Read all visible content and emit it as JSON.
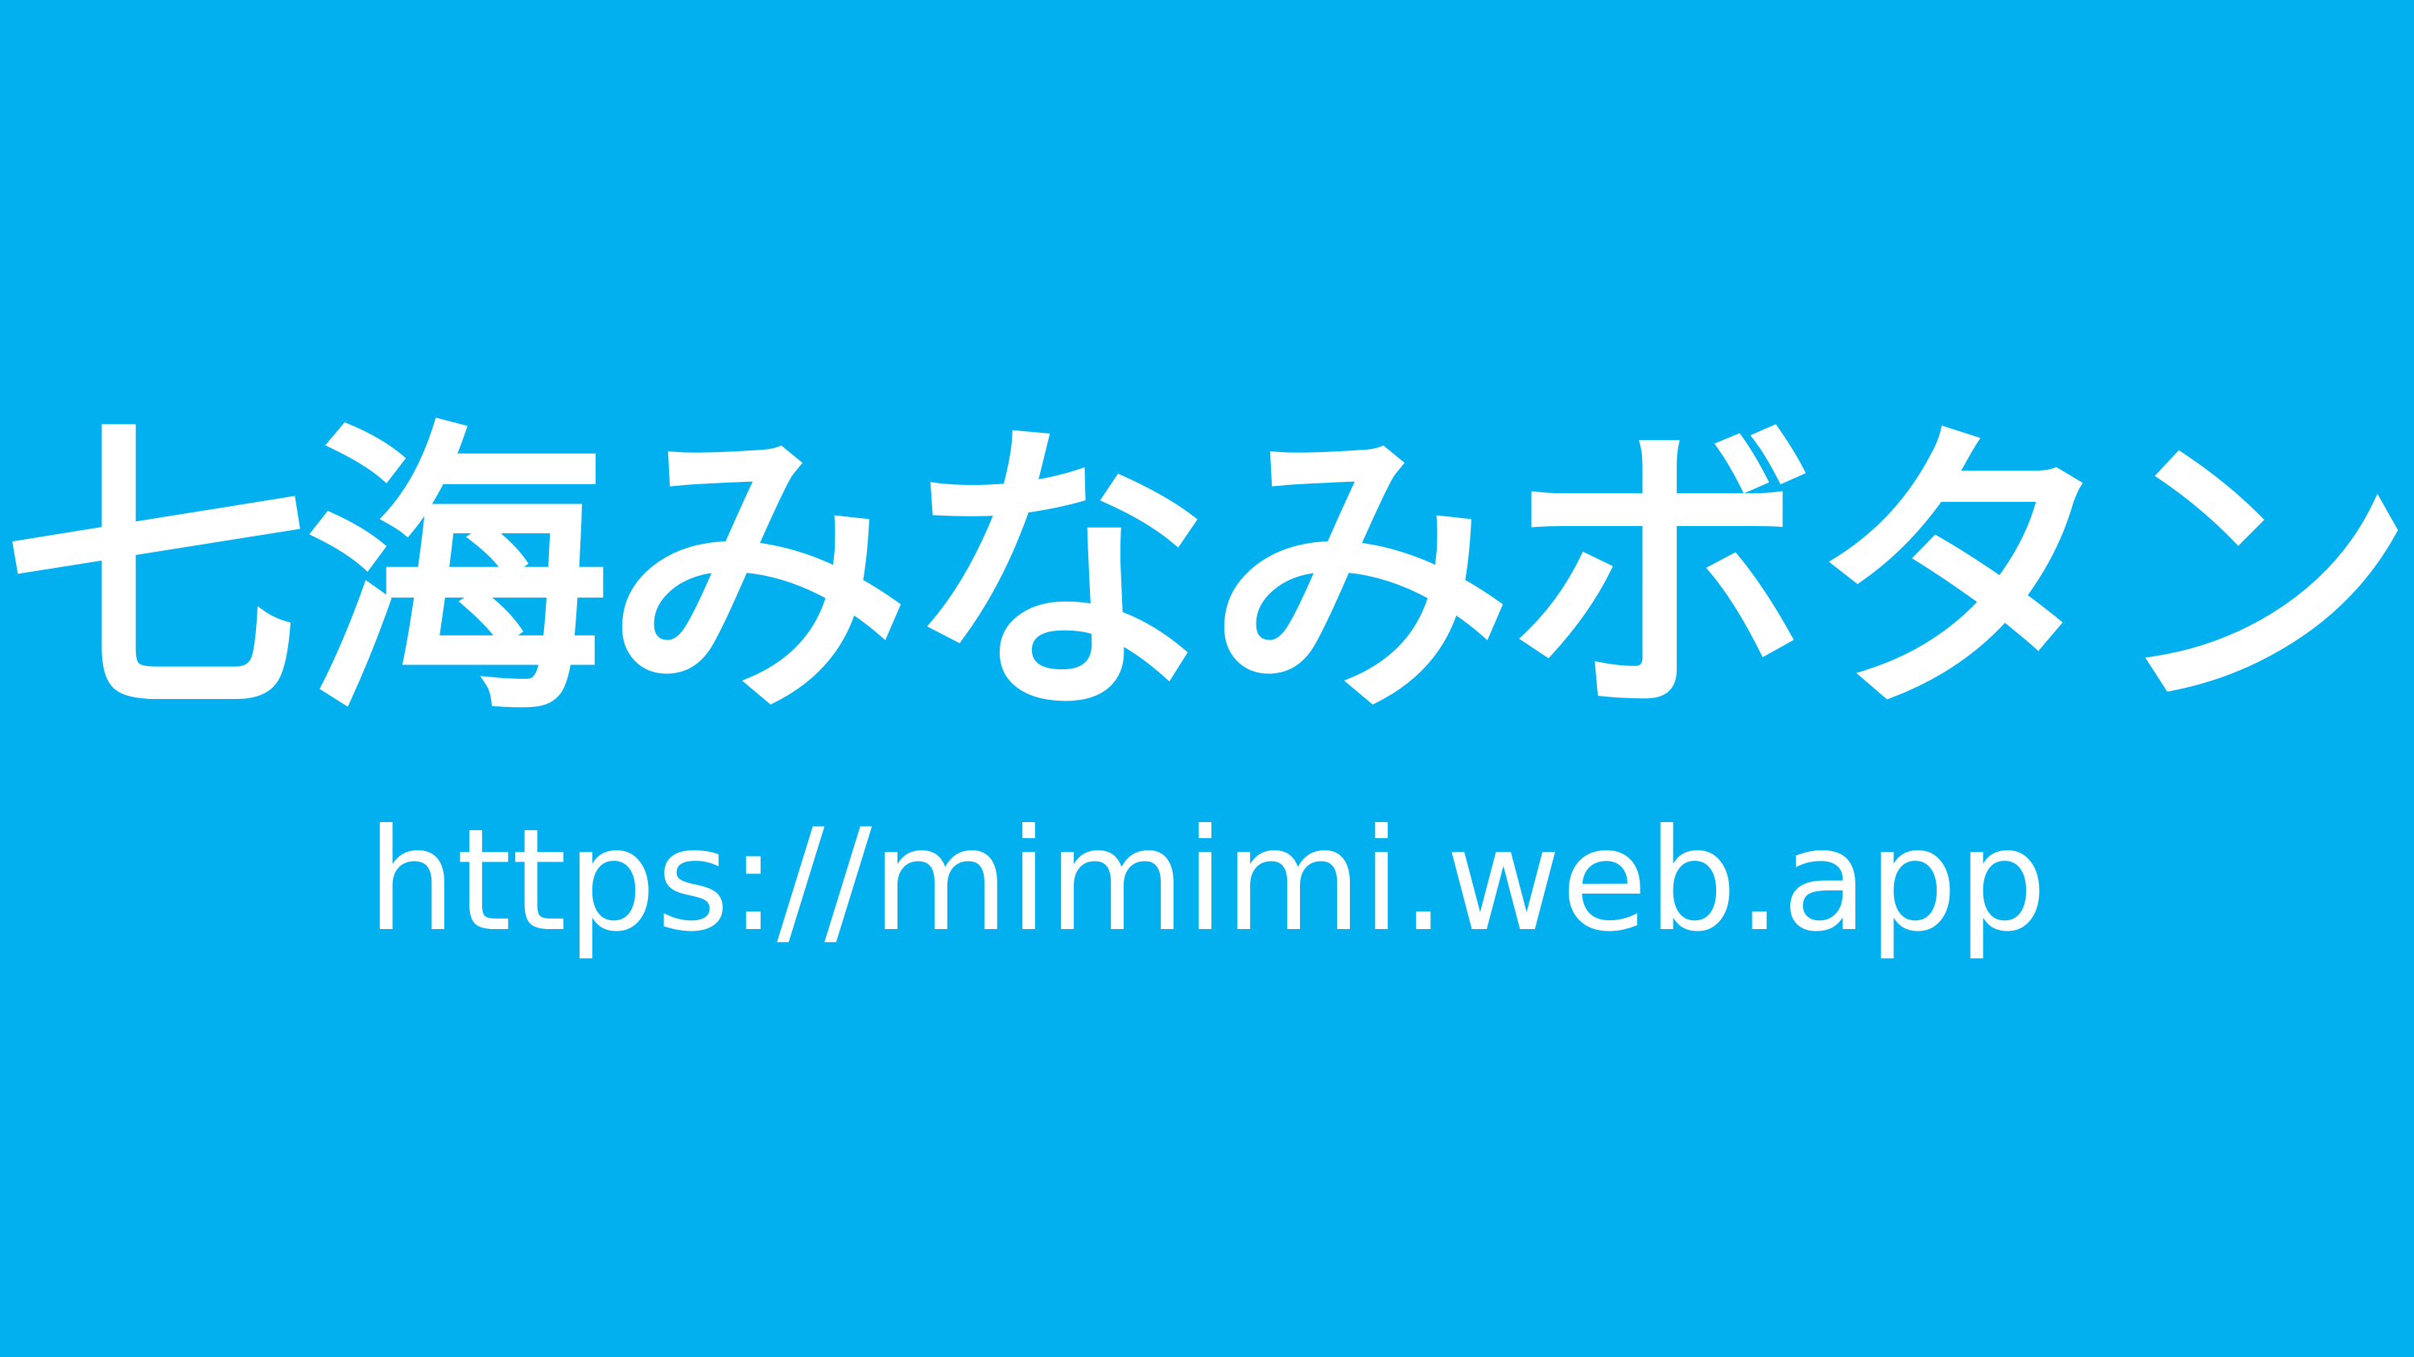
{
  "banner": {
    "title": "七海みなみボタン",
    "url": "https://mimimi.web.app",
    "background_color": "#02B0F0",
    "text_color": "#FFFFFF"
  }
}
